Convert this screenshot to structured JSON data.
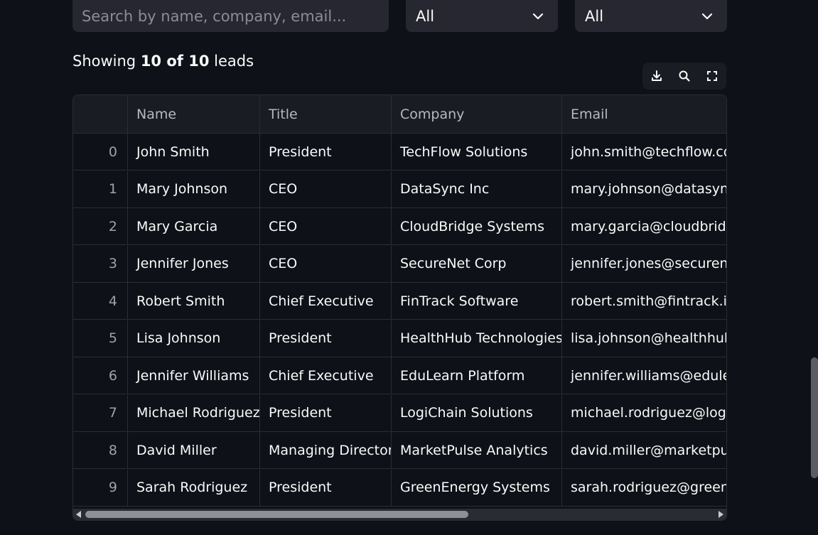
{
  "filters": {
    "search_placeholder": "Search by name, company, email...",
    "select1_value": "All",
    "select2_value": "All"
  },
  "summary": {
    "prefix": "Showing ",
    "shown": "10",
    "mid": " of ",
    "total": "10",
    "suffix": " leads"
  },
  "toolbar": {
    "icons": [
      "download-icon",
      "search-icon",
      "fullscreen-icon"
    ]
  },
  "table": {
    "columns": [
      "",
      "Name",
      "Title",
      "Company",
      "Email"
    ],
    "rows": [
      {
        "index": "0",
        "name": "John Smith",
        "title": "President",
        "company": "TechFlow Solutions",
        "email": "john.smith@techflow.com"
      },
      {
        "index": "1",
        "name": "Mary Johnson",
        "title": "CEO",
        "company": "DataSync Inc",
        "email": "mary.johnson@datasync.io"
      },
      {
        "index": "2",
        "name": "Mary Garcia",
        "title": "CEO",
        "company": "CloudBridge Systems",
        "email": "mary.garcia@cloudbridge.com"
      },
      {
        "index": "3",
        "name": "Jennifer Jones",
        "title": "CEO",
        "company": "SecureNet Corp",
        "email": "jennifer.jones@securenet.com"
      },
      {
        "index": "4",
        "name": "Robert Smith",
        "title": "Chief Executive",
        "company": "FinTrack Software",
        "email": "robert.smith@fintrack.io"
      },
      {
        "index": "5",
        "name": "Lisa Johnson",
        "title": "President",
        "company": "HealthHub Technologies",
        "email": "lisa.johnson@healthhub.com"
      },
      {
        "index": "6",
        "name": "Jennifer Williams",
        "title": "Chief Executive",
        "company": "EduLearn Platform",
        "email": "jennifer.williams@edulearn.com"
      },
      {
        "index": "7",
        "name": "Michael Rodriguez",
        "title": "President",
        "company": "LogiChain Solutions",
        "email": "michael.rodriguez@logichain.com"
      },
      {
        "index": "8",
        "name": "David Miller",
        "title": "Managing Director",
        "company": "MarketPulse Analytics",
        "email": "david.miller@marketpulse.com"
      },
      {
        "index": "9",
        "name": "Sarah Rodriguez",
        "title": "President",
        "company": "GreenEnergy Systems",
        "email": "sarah.rodriguez@greenenergy.com"
      }
    ]
  },
  "colors": {
    "background": "#0e1117",
    "input_bg": "#262730",
    "header_bg": "#1a1c23",
    "border": "#2b2d36"
  }
}
